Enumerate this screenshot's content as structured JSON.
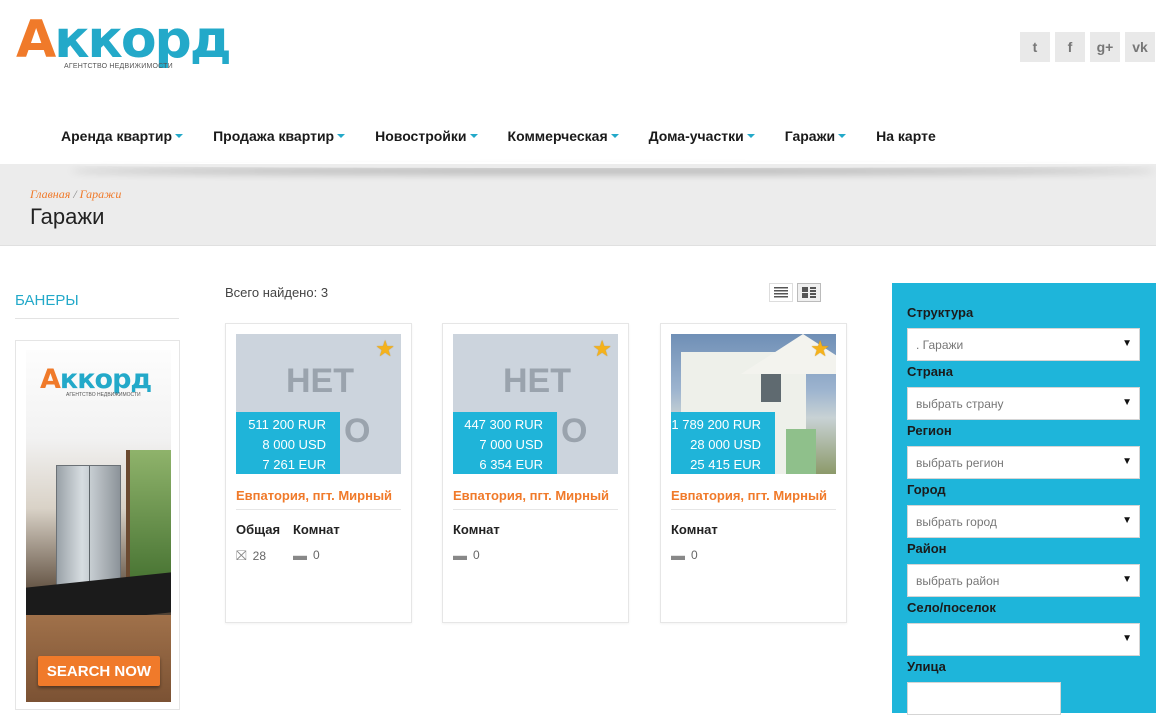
{
  "brand": {
    "logo_text_a": "A",
    "logo_text_rest": "ккорд",
    "logo_sub": "АГЕНТСТВО НЕДВИЖИМОСТИ"
  },
  "social": [
    {
      "icon": "twitter-icon",
      "glyph": "t"
    },
    {
      "icon": "facebook-icon",
      "glyph": "f"
    },
    {
      "icon": "google-plus-icon",
      "glyph": "g+"
    },
    {
      "icon": "vk-icon",
      "glyph": "vk"
    }
  ],
  "nav": {
    "items": [
      {
        "label": "Аренда квартир",
        "dropdown": true
      },
      {
        "label": "Продажа квартир",
        "dropdown": true
      },
      {
        "label": "Новостройки",
        "dropdown": true
      },
      {
        "label": "Коммерческая",
        "dropdown": true
      },
      {
        "label": "Дома-участки",
        "dropdown": true
      },
      {
        "label": "Гаражи",
        "dropdown": true
      },
      {
        "label": "На карте",
        "dropdown": false
      }
    ]
  },
  "breadcrumb": {
    "home": "Главная",
    "sep": "/",
    "current": "Гаражи"
  },
  "page_title": "Гаражи",
  "sidebar": {
    "title": "БАНЕРЫ",
    "banner": {
      "logo_a": "A",
      "logo_rest": "ккорд",
      "logo_sub": "АГЕНТСТВО НЕДВИЖИМОСТИ",
      "cta": "SEARCH NOW"
    }
  },
  "results": {
    "found_label": "Всего найдено:",
    "found_count": "3",
    "cards": [
      {
        "image": "no-image",
        "noimg_1": "НЕТ",
        "noimg_2": "О",
        "price_rur": "511 200 RUR",
        "price_usd": "8 000 USD",
        "price_eur": "7 261 EUR",
        "title": "Евпатория, пгт. Мирный",
        "attr1_label": "Общая",
        "attr1_value": "28",
        "attr2_label": "Комнат",
        "attr2_value": "0"
      },
      {
        "image": "no-image",
        "noimg_1": "НЕТ",
        "noimg_2": "О",
        "price_rur": "447 300 RUR",
        "price_usd": "7 000 USD",
        "price_eur": "6 354 EUR",
        "title": "Евпатория, пгт. Мирный",
        "attr2_label": "Комнат",
        "attr2_value": "0"
      },
      {
        "image": "photo",
        "price_rur": "1 789 200 RUR",
        "price_usd": "28 000 USD",
        "price_eur": "25 415 EUR",
        "title": "Евпатория, пгт. Мирный",
        "attr2_label": "Комнат",
        "attr2_value": "0"
      }
    ]
  },
  "filter": {
    "fields": [
      {
        "label": "Структура",
        "value": ". Гаражи"
      },
      {
        "label": "Страна",
        "value": "выбрать страну"
      },
      {
        "label": "Регион",
        "value": "выбрать регион"
      },
      {
        "label": "Город",
        "value": "выбрать город"
      },
      {
        "label": "Район",
        "value": "выбрать район"
      },
      {
        "label": "Село/поселок",
        "value": ""
      },
      {
        "label": "Улица",
        "value": ""
      }
    ],
    "arrow": "▼"
  },
  "colors": {
    "accent": "#1eb5da",
    "orange": "#f07a2a"
  }
}
